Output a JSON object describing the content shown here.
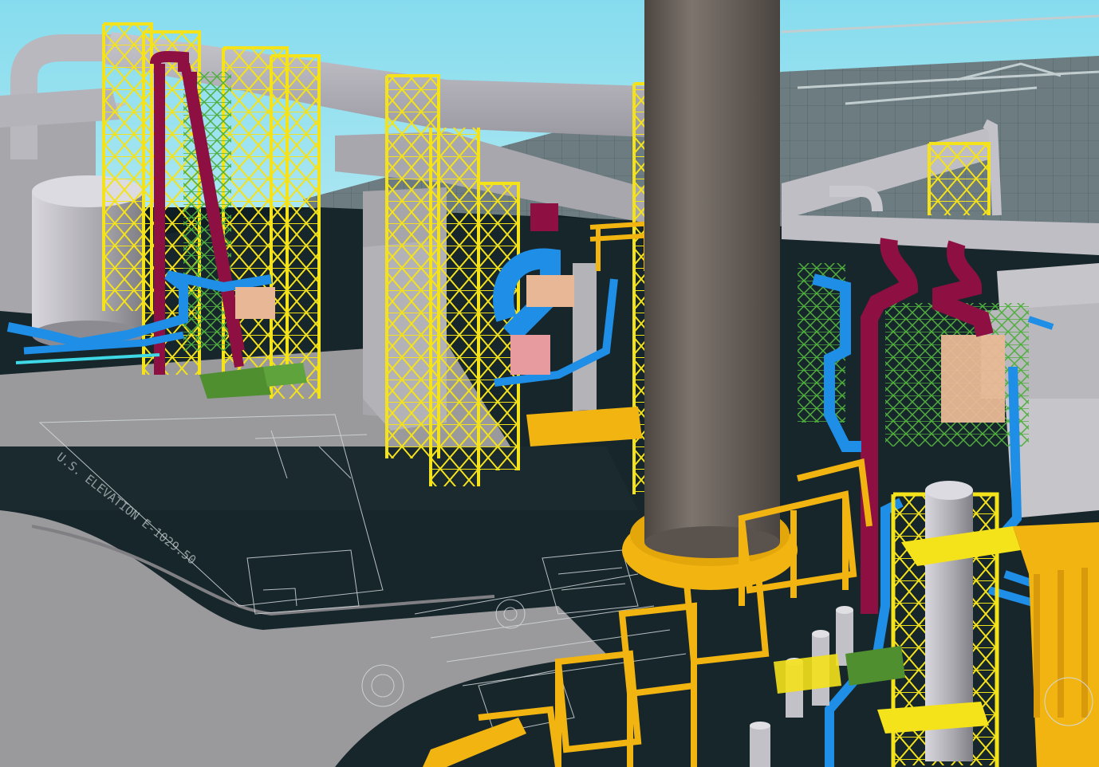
{
  "viewport": {
    "description_free_scene": true,
    "colors": {
      "sky": "#86dcee",
      "sky_far": "#a9e6f1",
      "concrete": "#9a9a9d",
      "concrete_dark": "#7d7d80",
      "ground_dark": "#17262b",
      "steel_yellow": "#f4e21b",
      "platform_orange": "#f2b410",
      "pipe_blue": "#1e8ee6",
      "pipe_maroon": "#8e1042",
      "duct_gray": "#b7b5bd",
      "stack_brown": "#6d6560",
      "equipment_green": "#5ea33c",
      "equipment_peach": "#e8b896",
      "cad_line": "#d4d9dc"
    }
  },
  "ground_annotation": {
    "text": "U.S. ELEVATION E-1029.50"
  }
}
